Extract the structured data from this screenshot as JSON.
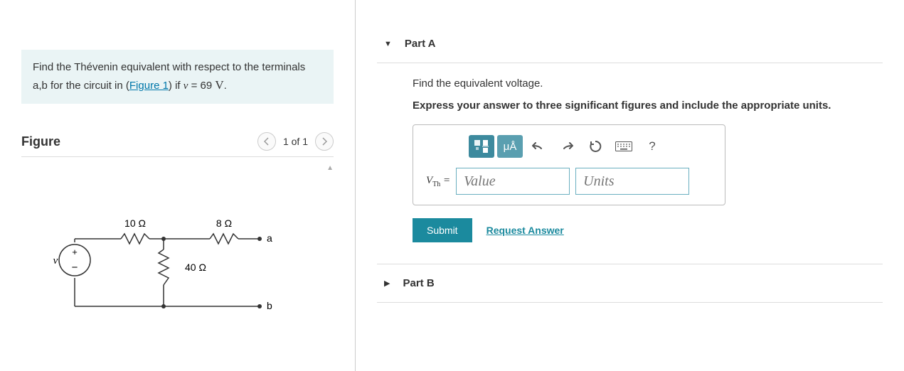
{
  "problem": {
    "text_pre": "Find the Thévenin equivalent with respect to the terminals a,b for the circuit in (",
    "link_text": "Figure 1",
    "text_mid": ") if ",
    "var": "v",
    "eq": " = 69 ",
    "unit": "V",
    "text_post": "."
  },
  "figure": {
    "title": "Figure",
    "nav_text": "1 of 1",
    "r10": "10 Ω",
    "r8": "8 Ω",
    "r40": "40 Ω",
    "v_label": "v",
    "a_label": "a",
    "b_label": "b"
  },
  "partA": {
    "title": "Part A",
    "instruction": "Find the equivalent voltage.",
    "instruction_bold": "Express your answer to three significant figures and include the appropriate units.",
    "var_label": "V",
    "var_sub": "Th",
    "eq": " = ",
    "value_placeholder": "Value",
    "units_placeholder": "Units",
    "submit": "Submit",
    "request": "Request Answer",
    "mu_a": "μÅ",
    "help": "?"
  },
  "partB": {
    "title": "Part B"
  }
}
